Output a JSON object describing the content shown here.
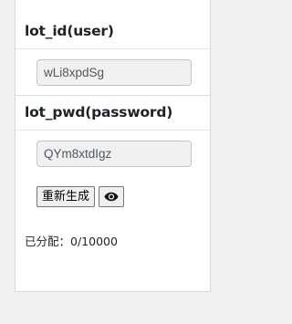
{
  "user_section": {
    "title": "lot_id(user)",
    "field_value": "wLi8xpdSg"
  },
  "password_section": {
    "title": "lot_pwd(password)",
    "field_value": "QYm8xtdIgz"
  },
  "buttons": {
    "regenerate_label": "重新生成",
    "show_password_icon": "eye-icon"
  },
  "allocation": {
    "label": "已分配：",
    "value": "0/10000"
  }
}
